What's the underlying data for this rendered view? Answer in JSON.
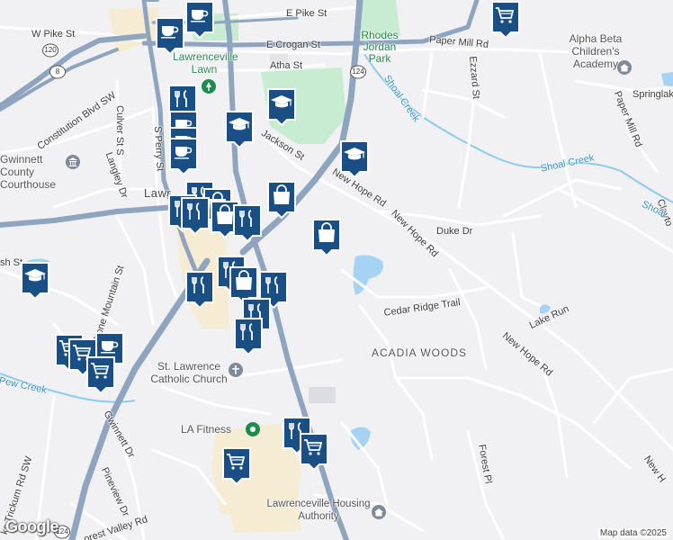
{
  "streets": {
    "e_pike": "E Pike St",
    "w_pike": "W Pike St",
    "e_crogan": "E Crogan St",
    "paper_mill_top": "Paper Mill Rd",
    "paper_mill_right": "Paper Mill Rd",
    "atha": "Atha St",
    "ezzard": "Ezzard St",
    "constitution": "Constitution Blvd SW",
    "culver": "Culver St S",
    "s_perry": "S Perry St",
    "langley": "Langley Dr",
    "jackson": "Jackson St",
    "new_hope_1": "New Hope Rd",
    "new_hope_2": "New Hope Rd",
    "new_hope_3": "New Hope Rd",
    "new_hope_4": "New H",
    "duke": "Duke Dr",
    "stone_mountain": "Stone Mountain St",
    "cedar_ridge": "Cedar Ridge Trail",
    "lake_run": "Lake Run",
    "gwinnett": "Gwinnett Dr",
    "pineview": "Pineview Dr",
    "forest_pl": "Forest Pl",
    "trickum": "ks Trickum Rd SW",
    "forest_valley": "orest Valley Rd",
    "sh_st": "sh St",
    "springlake": "Springlak",
    "clayton": "Clayto"
  },
  "places": {
    "rhodes_park": "Rhodes Jordan Park",
    "alpha_beta": "Alpha Beta Children's Academy",
    "lawrenceville_lawn": "Lawrenceville Lawn",
    "courthouse": "Gwinnett County Courthouse",
    "lawrenceville": "Lawr",
    "st_lawrence": "St. Lawrence Catholic Church",
    "la_fitness": "LA Fitness",
    "housing": "Lawrenceville Housing Authority",
    "acadia": "ACADIA WOODS"
  },
  "creeks": {
    "shoal_1": "Shoal Creek",
    "shoal_2": "Shoal Creek",
    "shoal_3": "Shoal",
    "pew": "Pew Creek"
  },
  "shields": [
    "120",
    "8",
    "124",
    "124"
  ],
  "pins": [
    {
      "icon": "coffee",
      "label": "Coffee shop"
    },
    {
      "icon": "coffee",
      "label": "Coffee shop"
    },
    {
      "icon": "grocery",
      "label": "Grocery"
    },
    {
      "icon": "restaurant",
      "label": "Restaurant"
    },
    {
      "icon": "school",
      "label": "School"
    },
    {
      "icon": "school",
      "label": "School"
    },
    {
      "icon": "school",
      "label": "School"
    },
    {
      "icon": "coffee",
      "label": "Coffee shop"
    },
    {
      "icon": "coffee",
      "label": "Coffee shop"
    },
    {
      "icon": "coffee",
      "label": "Coffee shop"
    },
    {
      "icon": "restaurant",
      "label": "Restaurant"
    },
    {
      "icon": "shopping",
      "label": "Shopping"
    },
    {
      "icon": "restaurant",
      "label": "Restaurant"
    },
    {
      "icon": "restaurant",
      "label": "Restaurant"
    },
    {
      "icon": "shopping",
      "label": "Shopping"
    },
    {
      "icon": "restaurant",
      "label": "Restaurant"
    },
    {
      "icon": "shopping",
      "label": "Shopping"
    },
    {
      "icon": "shopping",
      "label": "Shopping"
    },
    {
      "icon": "restaurant",
      "label": "Restaurant"
    },
    {
      "icon": "restaurant",
      "label": "Restaurant"
    },
    {
      "icon": "shopping",
      "label": "Shopping"
    },
    {
      "icon": "restaurant",
      "label": "Restaurant"
    },
    {
      "icon": "restaurant",
      "label": "Restaurant"
    },
    {
      "icon": "restaurant",
      "label": "Restaurant"
    },
    {
      "icon": "school",
      "label": "School"
    },
    {
      "icon": "coffee",
      "label": "Coffee shop"
    },
    {
      "icon": "grocery",
      "label": "Grocery"
    },
    {
      "icon": "grocery",
      "label": "Grocery"
    },
    {
      "icon": "grocery",
      "label": "Grocery"
    },
    {
      "icon": "restaurant",
      "label": "Restaurant"
    },
    {
      "icon": "grocery",
      "label": "Grocery"
    },
    {
      "icon": "grocery",
      "label": "Grocery"
    }
  ],
  "logo": "Google",
  "attribution": "Map data ©2025",
  "colors": {
    "pin": "#1a4f86",
    "highway": "#8fa4bf",
    "water": "#a6d3f4",
    "park": "#c8ecd1",
    "commercial": "#f7ecd2",
    "creek": "#7fc4ea"
  }
}
